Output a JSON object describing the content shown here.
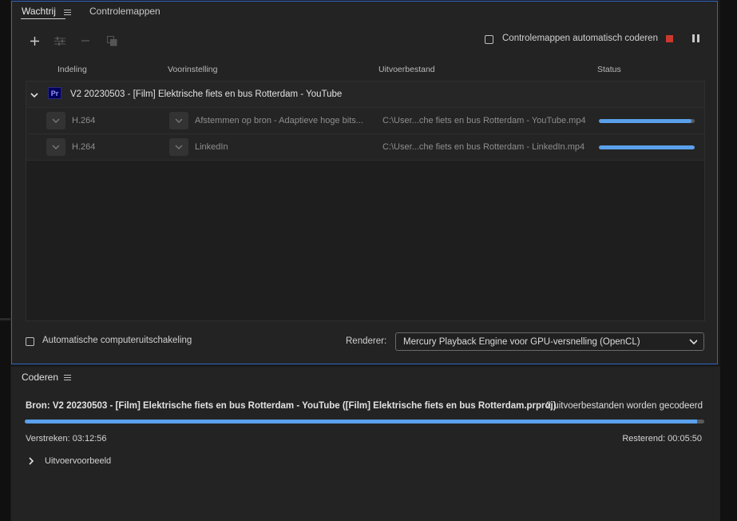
{
  "tabs": [
    {
      "label": "Wachtrij",
      "active": true
    },
    {
      "label": "Controlemappen",
      "active": false
    }
  ],
  "toolbar": {
    "add_icon": "plus-icon",
    "settings_icon": "sliders-icon",
    "remove_icon": "minus-icon",
    "duplicate_icon": "duplicate-icon",
    "auto_encode_label": "Controlemappen automatisch coderen",
    "auto_encode_checked": false,
    "stop_icon": "stop-icon",
    "pause_icon": "pause-icon"
  },
  "columns": [
    "Indeling",
    "Voorinstelling",
    "Uitvoerbestand",
    "Status"
  ],
  "queue": {
    "group": {
      "app_badge": "Pr",
      "title": "V2 20230503 - [Film] Elektrische fiets en bus Rotterdam - YouTube"
    },
    "rows": [
      {
        "format": "H.264",
        "preset": "Afstemmen op bron - Adaptieve hoge bits...",
        "output": "C:\\User...che fiets en bus Rotterdam - YouTube.mp4",
        "progress": 0.97
      },
      {
        "format": "H.264",
        "preset": "LinkedIn",
        "output": "C:\\User...che fiets en bus Rotterdam - LinkedIn.mp4",
        "progress": 1.0
      }
    ]
  },
  "footer": {
    "shutdown_label": "Automatische computeruitschakeling",
    "shutdown_checked": false,
    "renderer_label": "Renderer:",
    "renderer_value": "Mercury Playback Engine voor GPU-versnelling (OpenCL)"
  },
  "encoding": {
    "tab_label": "Coderen",
    "source": "Bron: V2 20230503 - [Film] Elektrische fiets en bus Rotterdam - YouTube ([Film] Elektrische fiets en bus Rotterdam.prproj)",
    "count": "2 uitvoerbestanden worden gecodeerd",
    "progress": 0.99,
    "elapsed": "Verstreken: 03:12:56",
    "remaining": "Resterend: 00:05:50",
    "preview_label": "Uitvoervoorbeeld"
  },
  "colors": {
    "accent": "#5aa0ea",
    "stop": "#c9392e",
    "panel_border": "#2f66c4",
    "premiere_badge": "#00005b"
  }
}
